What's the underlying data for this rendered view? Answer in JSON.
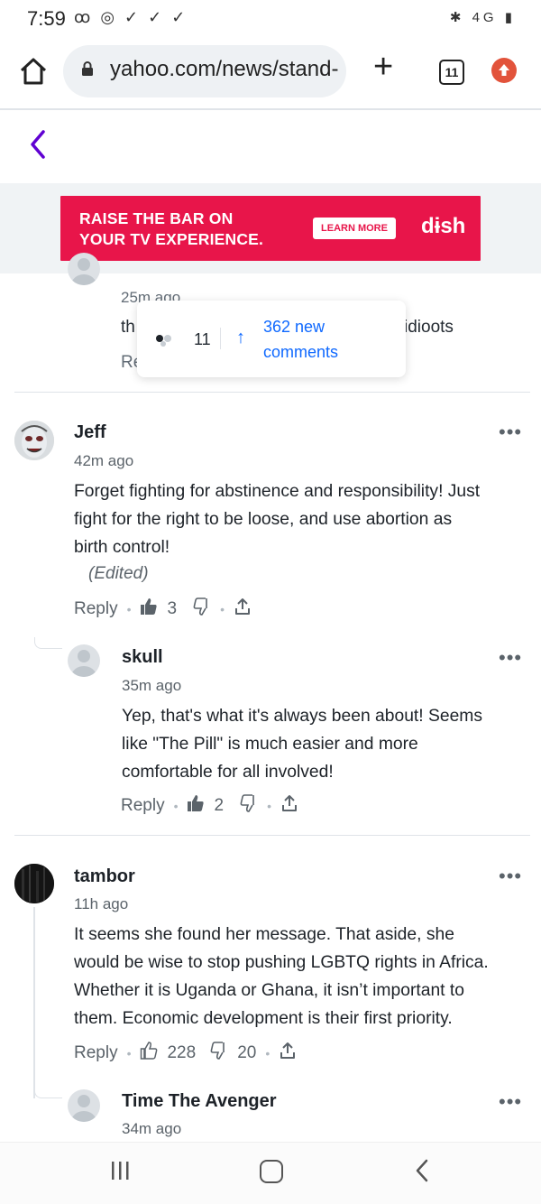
{
  "status_bar": {
    "time": "7:59",
    "left_icons": "ꝏ ◎ ✓ ✓ ✓",
    "right_icons": "✱ 4G ▮"
  },
  "browser": {
    "url": "yahoo.com/news/stand-",
    "tab_count": "11"
  },
  "ad": {
    "headline_line1": "RAISE THE BAR ON",
    "headline_line2": "YOUR TV EXPERIENCE.",
    "cta": "LEARN MORE",
    "brand": "dɨsh"
  },
  "previous_comment": {
    "time": "25m ago",
    "text_start": "th",
    "text_end": "idioots",
    "reply_fragment": "Re"
  },
  "floating_pill": {
    "user_count": "11",
    "new_comments": "362 new comments"
  },
  "comments": [
    {
      "name": "Jeff",
      "time": "42m ago",
      "text_line1": "Forget fighting for abstinence and responsibility! Just",
      "text_line2": "fight for the right to be loose, and use abortion as",
      "text_line3": "birth control!",
      "edited": "(Edited)",
      "reply": "Reply",
      "likes": "3",
      "dislikes": "",
      "more": "•••"
    },
    {
      "name": "skull",
      "time": "35m ago",
      "text_line1": "Yep, that's what it's always been about! Seems",
      "text_line2": "like \"The Pill\" is much easier and more",
      "text_line3": "comfortable for all involved!",
      "reply": "Reply",
      "likes": "2",
      "dislikes": "",
      "more": "•••"
    },
    {
      "name": "tambor",
      "time": "11h ago",
      "text_line1": "It seems she found her message. That aside, she",
      "text_line2": "would be wise to stop pushing LGBTQ rights in Africa.",
      "text_line3": "Whether it is Uganda or Ghana, it isn’t important to",
      "text_line4": "them. Economic development is their first priority.",
      "reply": "Reply",
      "likes": "228",
      "dislikes": "20",
      "more": "•••"
    },
    {
      "name": "Time The Avenger",
      "time": "34m ago",
      "more": "•••"
    }
  ],
  "colors": {
    "accent": "#0f69ff",
    "ad_bg": "#e8154a",
    "back_arrow": "#6001d2"
  }
}
